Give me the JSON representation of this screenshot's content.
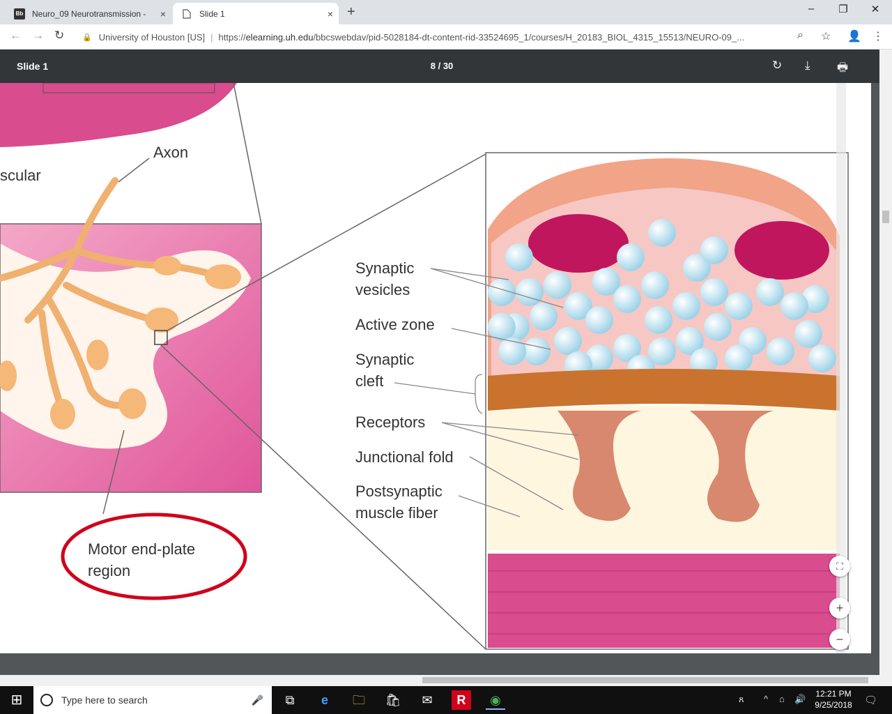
{
  "tabs": [
    {
      "fav": "Bb",
      "title": "Neuro_09 Neurotransmission - ",
      "close": "×"
    },
    {
      "fav": "",
      "title": "Slide 1",
      "close": "×"
    }
  ],
  "new_tab": "+",
  "window": {
    "minimize": "–",
    "restore": "❐",
    "close": "✕"
  },
  "nav": {
    "back": "←",
    "forward": "→",
    "reload": "↻"
  },
  "omnibox": {
    "lock": "🔒",
    "org": "University of Houston [US]",
    "sep": "|",
    "scheme": "https://",
    "host": "elearning.uh.edu",
    "path": "/bbcswebdav/pid-5028184-dt-content-rid-33524695_1/courses/H_20183_BIOL_4315_15513/NEURO-09_..."
  },
  "toolbar_icons": {
    "zoom": "⌕",
    "star": "☆",
    "account": "👤",
    "menu": "⋮"
  },
  "pdf": {
    "title": "Slide 1",
    "current_page": "8",
    "separator": "/",
    "total_pages": "30",
    "rotate": "↻",
    "download": "⤓",
    "print": "🖶"
  },
  "figure": {
    "labels": {
      "axon": "Axon",
      "muscular": "scular",
      "synaptic_vesicles_1": "Synaptic",
      "synaptic_vesicles_2": "vesicles",
      "active_zone": "Active zone",
      "synaptic_cleft_1": "Synaptic",
      "synaptic_cleft_2": "cleft",
      "receptors": "Receptors",
      "junctional_fold": "Junctional fold",
      "postsynaptic_1": "Postsynaptic",
      "postsynaptic_2": "muscle fiber",
      "motor_1": "Motor end-plate",
      "motor_2": "region"
    },
    "colors": {
      "muscle": "#e0559a",
      "terminal": "#f5c08a",
      "vesicle": "#bfe6f3",
      "annotation": "#d0021b"
    }
  },
  "zoom": {
    "fit": "⛶",
    "in": "+",
    "out": "−"
  },
  "taskbar": {
    "start": "⊞",
    "search_placeholder": "Type here to search",
    "mic": "🎤",
    "apps": [
      "⧉",
      "e",
      "🗀",
      "🛍",
      "✉",
      "R",
      "◉"
    ],
    "tray": [
      "ጸ",
      "^",
      "⌂",
      "🔊"
    ],
    "time": "12:21 PM",
    "date": "9/25/2018",
    "notify": "🗨"
  }
}
